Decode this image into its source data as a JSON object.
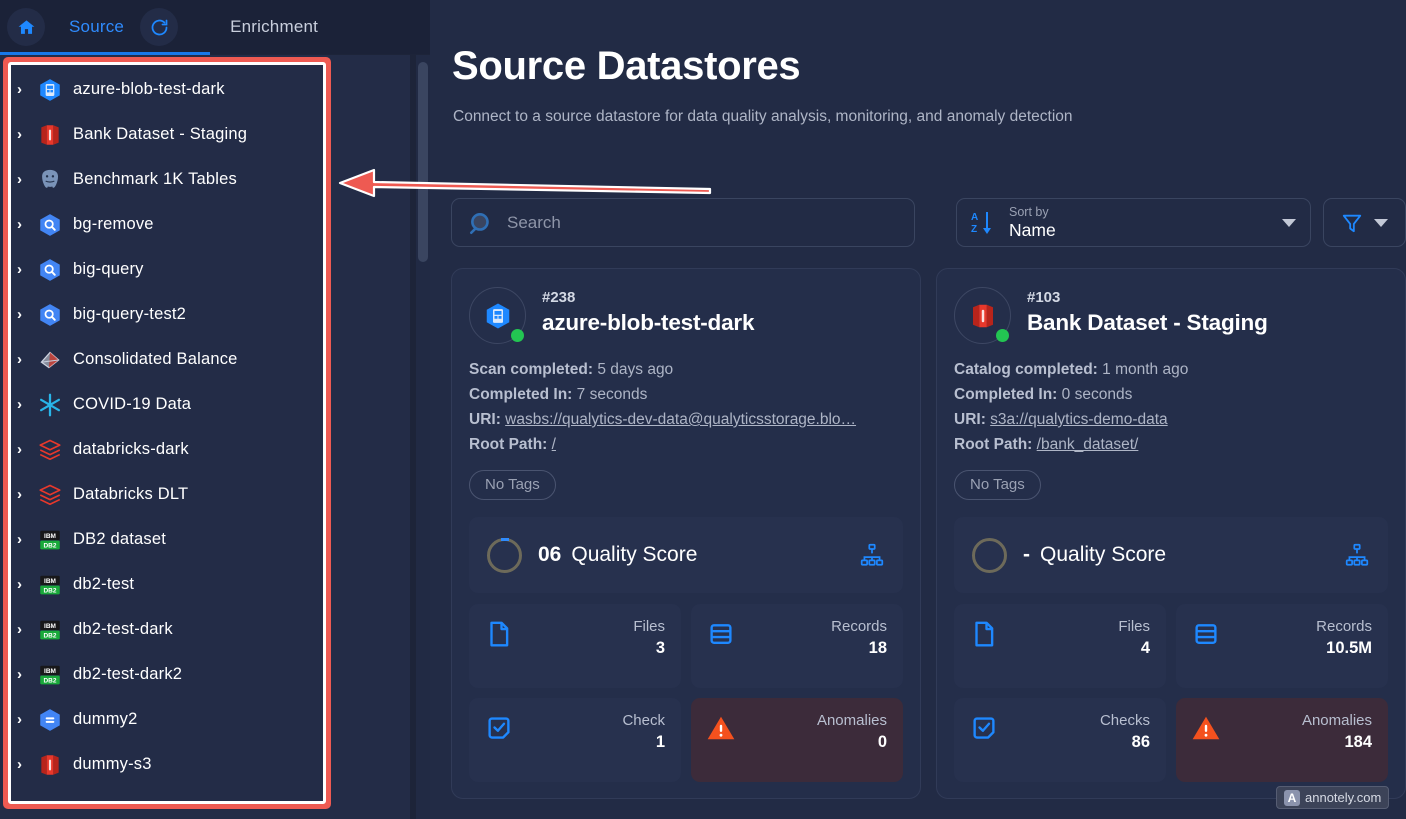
{
  "topbar": {
    "home_icon": "home-icon",
    "tabs": [
      {
        "label": "Source",
        "active": true
      },
      {
        "label": "Enrichment",
        "active": false
      }
    ],
    "refresh_icon": "refresh-icon",
    "collapse_icon": "chevron-left-icon"
  },
  "sidebar": {
    "items": [
      {
        "label": "azure-blob-test-dark",
        "icon": "azure-blob-icon"
      },
      {
        "label": "Bank Dataset - Staging",
        "icon": "aws-s3-icon"
      },
      {
        "label": "Benchmark 1K Tables",
        "icon": "postgresql-icon"
      },
      {
        "label": "bg-remove",
        "icon": "bigquery-icon"
      },
      {
        "label": "big-query",
        "icon": "bigquery-icon"
      },
      {
        "label": "big-query-test2",
        "icon": "bigquery-icon"
      },
      {
        "label": "Consolidated Balance",
        "icon": "apache-spark-icon"
      },
      {
        "label": "COVID-19 Data",
        "icon": "snowflake-icon"
      },
      {
        "label": "databricks-dark",
        "icon": "databricks-icon"
      },
      {
        "label": "Databricks DLT",
        "icon": "databricks-icon"
      },
      {
        "label": "DB2 dataset",
        "icon": "ibm-db2-icon"
      },
      {
        "label": "db2-test",
        "icon": "ibm-db2-icon"
      },
      {
        "label": "db2-test-dark",
        "icon": "ibm-db2-icon"
      },
      {
        "label": "db2-test-dark2",
        "icon": "ibm-db2-icon"
      },
      {
        "label": "dummy2",
        "icon": "google-cloud-icon"
      },
      {
        "label": "dummy-s3",
        "icon": "aws-s3-icon"
      }
    ]
  },
  "main": {
    "title": "Source Datastores",
    "subtitle": "Connect to a source datastore for data quality analysis, monitoring, and anomaly detection"
  },
  "toolbar": {
    "search_placeholder": "Search",
    "search_value": "",
    "sort_label": "Sort by",
    "sort_value": "Name",
    "sort_options": [
      "Name"
    ],
    "filter_icon": "filter-icon"
  },
  "cards": [
    {
      "id": "#238",
      "title": "azure-blob-test-dark",
      "icon": "azure-blob-icon",
      "status": "online",
      "status_color": "#23c552",
      "meta": [
        {
          "key": "Scan completed:",
          "value": "5 days ago",
          "link": false
        },
        {
          "key": "Completed In:",
          "value": "7 seconds",
          "link": false
        },
        {
          "key": "URI:",
          "value": "wasbs://qualytics-dev-data@qualyticsstorage.blo…",
          "link": true
        },
        {
          "key": "Root Path:",
          "value": "/",
          "link": true
        }
      ],
      "tag": "No Tags",
      "quality_score": "06",
      "quality_label": "Quality Score",
      "quality_percent": 6,
      "metrics": [
        {
          "label": "Files",
          "value": "3",
          "icon": "file-icon",
          "danger": false
        },
        {
          "label": "Records",
          "value": "18",
          "icon": "records-icon",
          "danger": false
        },
        {
          "label": "Check",
          "value": "1",
          "icon": "check-icon",
          "danger": false
        },
        {
          "label": "Anomalies",
          "value": "0",
          "icon": "warning-icon",
          "danger": true
        }
      ]
    },
    {
      "id": "#103",
      "title": "Bank Dataset - Staging",
      "icon": "aws-s3-icon",
      "status": "online",
      "status_color": "#23c552",
      "meta": [
        {
          "key": "Catalog completed:",
          "value": "1 month ago",
          "link": false
        },
        {
          "key": "Completed In:",
          "value": "0 seconds",
          "link": false
        },
        {
          "key": "URI:",
          "value": "s3a://qualytics-demo-data",
          "link": true
        },
        {
          "key": "Root Path:",
          "value": "/bank_dataset/",
          "link": true
        }
      ],
      "tag": "No Tags",
      "quality_score": "-",
      "quality_label": "Quality Score",
      "quality_percent": 0,
      "metrics": [
        {
          "label": "Files",
          "value": "4",
          "icon": "file-icon",
          "danger": false
        },
        {
          "label": "Records",
          "value": "10.5M",
          "icon": "records-icon",
          "danger": false
        },
        {
          "label": "Checks",
          "value": "86",
          "icon": "check-icon",
          "danger": false
        },
        {
          "label": "Anomalies",
          "value": "184",
          "icon": "warning-icon",
          "danger": true
        }
      ]
    }
  ],
  "annotations": {
    "highlight_color": "#ee5a52",
    "arrow": "left-arrow",
    "watermark_badge": "A",
    "watermark_text": "annotely.com"
  }
}
